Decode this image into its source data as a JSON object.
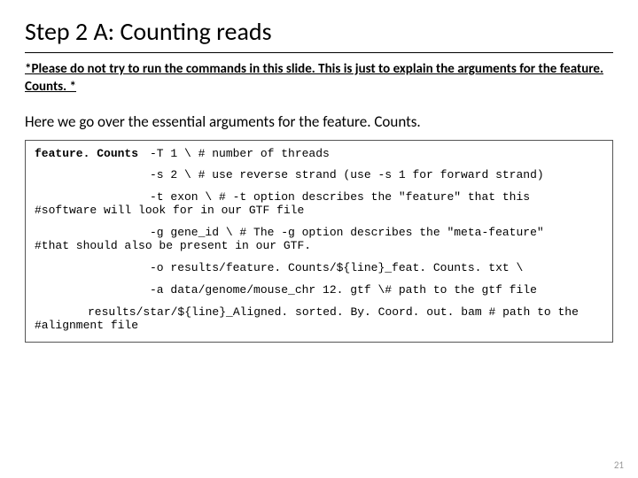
{
  "title": "Step 2 A: Counting reads",
  "warning": "*Please do not try to run the commands in this slide. This is just to explain the arguments for the feature. Counts. *",
  "intro": "Here we go over the essential arguments for the feature. Counts.",
  "cmd": "feature. Counts",
  "lines": {
    "l1": "-T 1 \\ # number of threads",
    "l2": "-s 2 \\ # use reverse strand (use -s 1 for forward strand)",
    "l3a": "-t exon \\ # -t option describes the \"feature\" that this",
    "l3b": "#software will look for in our GTF file",
    "l4a": "-g gene_id \\ # The -g option describes the \"meta-feature\"",
    "l4b": "#that should also be present in our GTF.",
    "l5": "-o results/feature. Counts/${line}_feat. Counts. txt \\",
    "l6": "-a data/genome/mouse_chr 12. gtf \\# path to the gtf file",
    "l7a": "results/star/${line}_Aligned. sorted. By. Coord. out. bam # path to the",
    "l7b": "#alignment file"
  },
  "page": "21"
}
